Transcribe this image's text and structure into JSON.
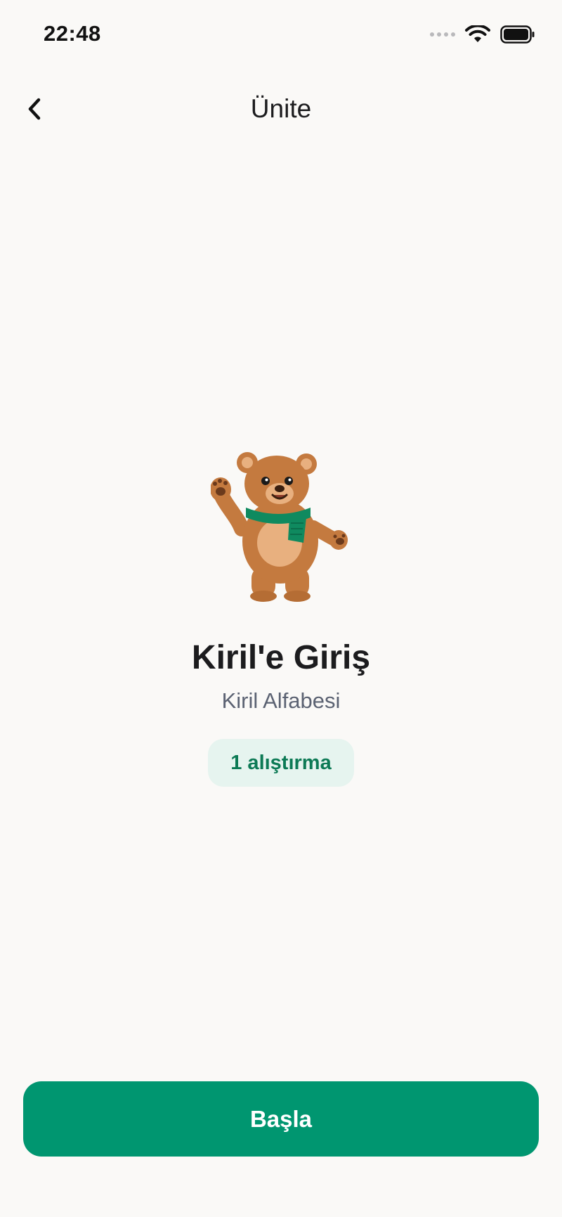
{
  "status_bar": {
    "time": "22:48",
    "icons": [
      "cellular-signal-icon",
      "wifi-icon",
      "battery-icon"
    ]
  },
  "nav": {
    "title": "Ünite",
    "back_icon": "chevron-left-icon"
  },
  "unit": {
    "mascot": "bear-mascot",
    "title": "Kiril'e Giriş",
    "subtitle": "Kiril Alfabesi",
    "exercise_count_label": "1 alıştırma"
  },
  "actions": {
    "start_label": "Başla"
  },
  "colors": {
    "background": "#faf9f7",
    "accent": "#009670",
    "badge_bg": "#e6f4ef",
    "badge_text": "#0d7a55",
    "subtitle_text": "#5b6272",
    "scarf": "#0f8a5f",
    "bear_fur": "#c47a3f"
  }
}
